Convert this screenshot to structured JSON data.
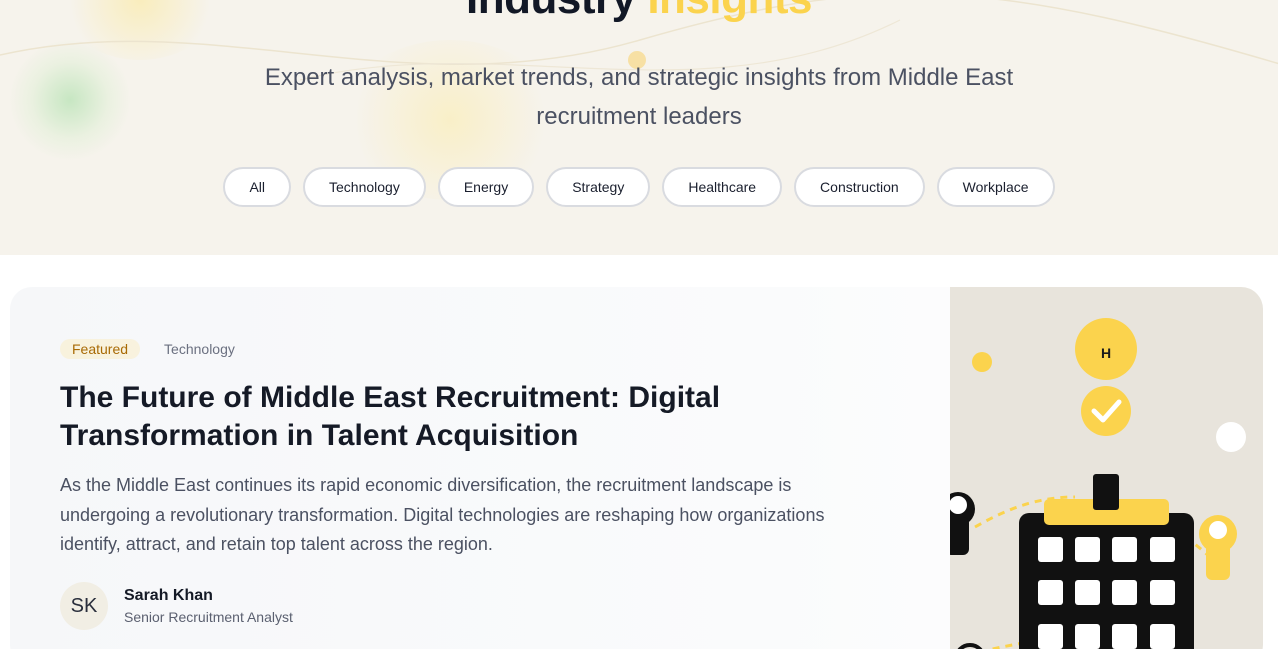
{
  "hero": {
    "title_main": "Industry",
    "title_accent": "Insights",
    "subtitle": "Expert analysis, market trends, and strategic insights from Middle East recruitment leaders",
    "filters": [
      "All",
      "Technology",
      "Energy",
      "Strategy",
      "Healthcare",
      "Construction",
      "Workplace"
    ]
  },
  "featured": {
    "badge": "Featured",
    "category": "Technology",
    "title": "The Future of Middle East Recruitment: Digital Transformation in Talent Acquisition",
    "excerpt": "As the Middle East continues its rapid economic diversification, the recruitment landscape is undergoing a revolutionary transformation. Digital technologies are reshaping how organizations identify, attract, and retain top talent across the region.",
    "author": {
      "initials": "SK",
      "name": "Sarah Khan",
      "role": "Senior Recruitment Analyst"
    },
    "illustration": {
      "building_letter": "H",
      "icons": [
        "check-icon",
        "building-icon",
        "person-icon"
      ]
    }
  },
  "colors": {
    "accent": "#fbd34d",
    "hero_bg": "#f6f3ec",
    "badge_text": "#a86a05",
    "illustration_bg": "#e8e4dc"
  }
}
